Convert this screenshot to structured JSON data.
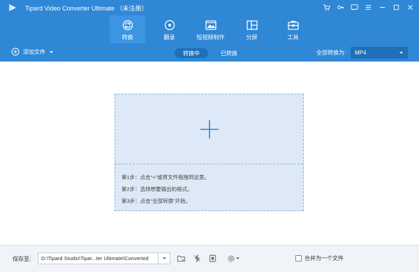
{
  "app": {
    "title": "Tipard Video Converter Ultimate （未注册）"
  },
  "nav": {
    "tabs": [
      {
        "label": "转换",
        "icon": "convert-icon",
        "active": true
      },
      {
        "label": "翻录",
        "icon": "rip-disc-icon",
        "active": false
      },
      {
        "label": "短视频制作",
        "icon": "mv-image-icon",
        "active": false
      },
      {
        "label": "分屏",
        "icon": "collage-icon",
        "active": false
      },
      {
        "label": "工具",
        "icon": "toolbox-icon",
        "active": false
      }
    ]
  },
  "toolbar": {
    "add_file_label": "添加文件",
    "segments": [
      "转换中",
      "已转换"
    ],
    "convert_all_label": "全部转换为:",
    "format_value": "MP4"
  },
  "drop_zone": {
    "steps": [
      "第1步：点击“+”或将文件拖拽到这里。",
      "第2步：选择想要输出的格式。",
      "第3步：点击“全部转换”开始。"
    ]
  },
  "footer": {
    "save_label": "保存至:",
    "path_value": "D:\\Tipard Studio\\Tipar...ter Ultimate\\Converted",
    "merge_label": "合并为一个文件"
  },
  "colors": {
    "header": "#2f87d6",
    "active_tab": "#3c95e2",
    "segment_active": "#1f6fb9",
    "drop_zone": "#dde9f6",
    "accent_plus": "#2f87d6"
  }
}
